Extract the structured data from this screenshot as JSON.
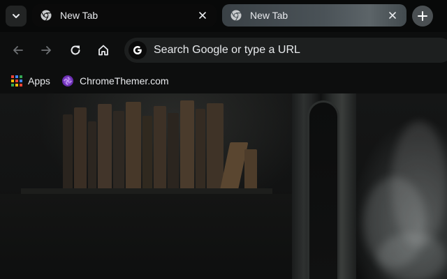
{
  "tabs": [
    {
      "title": "New Tab",
      "active": true
    },
    {
      "title": "New Tab",
      "active": false
    }
  ],
  "icons": {
    "tab_search": "chevron-down-icon",
    "favicon": "chrome-icon",
    "close": "close-icon",
    "new_tab": "plus-icon",
    "back": "arrow-left-icon",
    "forward": "arrow-right-icon",
    "reload": "reload-icon",
    "home": "home-icon",
    "search_engine": "google-g-icon",
    "apps": "apps-grid-icon",
    "bookmark": "chromethemer-icon"
  },
  "omnibox": {
    "placeholder": "Search Google or type a URL"
  },
  "bookmarks": [
    {
      "label": "Apps"
    },
    {
      "label": "ChromeThemer.com"
    }
  ],
  "colors": {
    "frame": "#080909",
    "toolbar": "#0d0e0e",
    "omnibox": "#1d1f1f",
    "text": "#e8eaed",
    "inactive_tab": "#4a5257"
  }
}
